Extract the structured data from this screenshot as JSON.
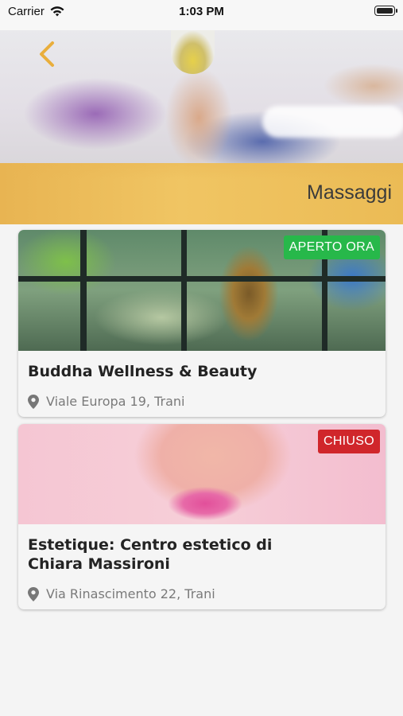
{
  "status_bar": {
    "carrier": "Carrier",
    "time": "1:03 PM"
  },
  "header": {
    "title": "Massaggi",
    "back_icon": "chevron-left-icon",
    "accent_color": "#F0B94F"
  },
  "listings": [
    {
      "name": "Buddha Wellness & Beauty",
      "address": "Viale Europa 19, Trani",
      "status": "APERTO ORA",
      "status_color": "#27B84A"
    },
    {
      "name_line1": "Estetique: Centro estetico di",
      "name_line2": "Chiara Massironi",
      "address": "Via Rinascimento 22, Trani",
      "status": "CHIUSO",
      "status_color": "#D0262B"
    }
  ]
}
